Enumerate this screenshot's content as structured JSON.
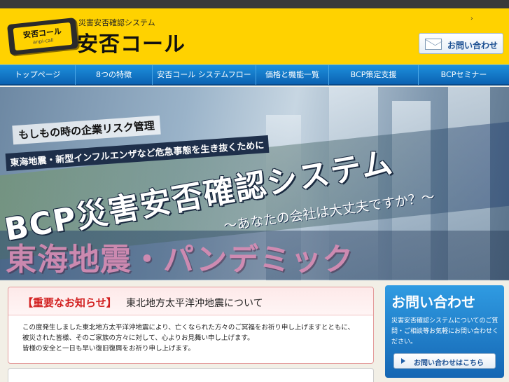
{
  "header": {
    "arrow": "›",
    "logo": {
      "card_text": "安否コール",
      "card_sub": "anpi-call",
      "tagline": "災害安否確認システム",
      "name": "安否コール"
    },
    "contact_button": {
      "label": "お問い合わせ",
      "icon": "mail-icon"
    }
  },
  "nav": {
    "items": [
      {
        "label": "トップページ"
      },
      {
        "label": "8つの特徴"
      },
      {
        "label": "安否コール システムフロー"
      },
      {
        "label": "価格と機能一覧"
      },
      {
        "label": "BCP策定支援"
      },
      {
        "label": "BCPセミナー"
      }
    ]
  },
  "hero": {
    "line1": "もしもの時の企業リスク管理",
    "line2": "東海地震・新型インフルエンザなど危急事態を生き抜くために",
    "title": "BCP災害安否確認システム",
    "subtitle": "～あなたの会社は大丈夫ですか？～",
    "pink": "東海地震・パンデミック"
  },
  "notice": {
    "tag": "【重要なお知らせ】",
    "title": "東北地方太平洋沖地震について",
    "lines": [
      "この度発生しました東北地方太平洋沖地震により、亡くなられた方々のご冥福をお祈り申し上げますとともに、",
      "被災された皆様、そのご家族の方々に対して、心よりお見舞い申し上げます。",
      "皆様の安全と一日も早い復旧復興をお祈り申し上げます。"
    ]
  },
  "sidebar": {
    "title": "お問い合わせ",
    "text": "災害安否確認システムについてのご質問・ご相談等お気軽にお問い合わせください。",
    "button": {
      "label": "お問い合わせはこちら",
      "icon": "arrow-right-icon"
    }
  },
  "colors": {
    "header_bg": "#ffd200",
    "nav_bg": "#0b62b2",
    "notice_tag": "#d22020",
    "side_bg": "#1566b3"
  }
}
